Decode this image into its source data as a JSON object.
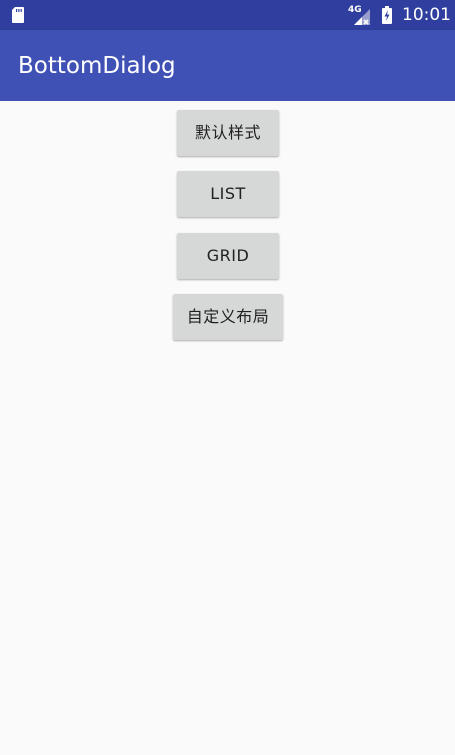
{
  "status_bar": {
    "network_label": "4G",
    "time": "10:01",
    "icons": [
      "sd-card-icon",
      "signal-icon",
      "battery-charging-icon"
    ]
  },
  "app_bar": {
    "title": "BottomDialog"
  },
  "buttons": {
    "default_style": "默认样式",
    "list": "LIST",
    "grid": "GRID",
    "custom_layout": "自定义布局"
  },
  "colors": {
    "status_bar": "#303f9f",
    "app_bar": "#3f51b5",
    "background": "#fafafa",
    "button": "#d6d7d7",
    "button_text": "#212121"
  }
}
